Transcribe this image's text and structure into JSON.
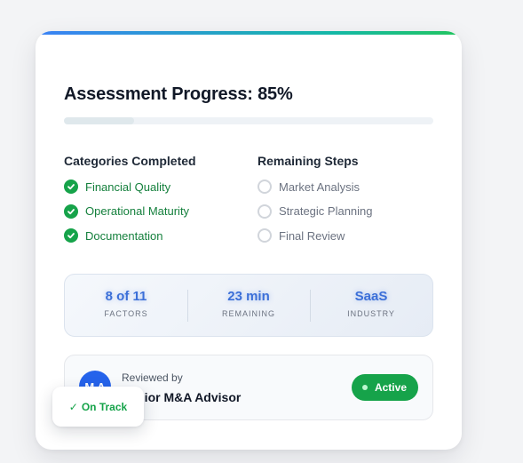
{
  "card": {
    "title": "Assessment Progress: 85%",
    "progress_percent": 85,
    "accent_colors": [
      "#3b82f6",
      "#14b8a6",
      "#22c55e"
    ]
  },
  "completed": {
    "heading": "Categories Completed",
    "items": [
      "Financial Quality",
      "Operational Maturity",
      "Documentation"
    ],
    "icon": "check-circle-icon",
    "color": "#16a34a"
  },
  "remaining": {
    "heading": "Remaining Steps",
    "items": [
      "Market Analysis",
      "Strategic Planning",
      "Final Review"
    ],
    "icon": "empty-circle-icon"
  },
  "stats": [
    {
      "value": "8 of 11",
      "label": "FACTORS"
    },
    {
      "value": "23 min",
      "label": "REMAINING"
    },
    {
      "value": "SaaS",
      "label": "INDUSTRY"
    }
  ],
  "reviewer": {
    "avatar_initials": "M A",
    "label": "Reviewed by",
    "name": "Senior M&A Advisor",
    "status": "Active",
    "status_color": "#16a34a"
  },
  "badge": {
    "icon": "checkmark-icon",
    "check": "✓",
    "label": "On Track"
  }
}
